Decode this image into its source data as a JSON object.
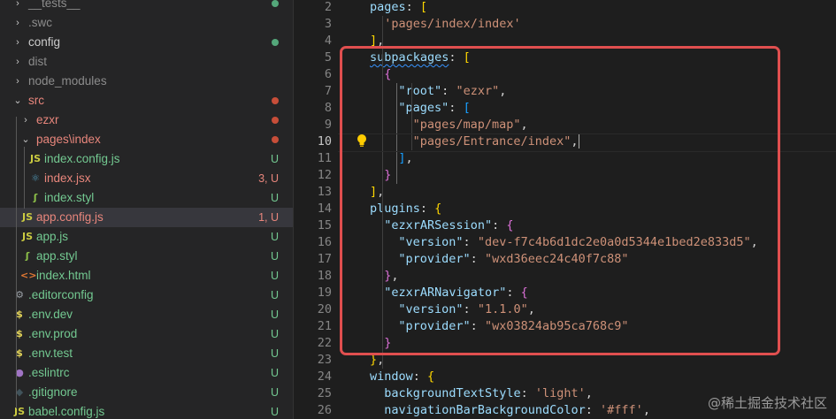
{
  "explorer": {
    "items": [
      {
        "name": "__tests__",
        "type": "folder",
        "indent": 0,
        "color": "#8c8c8c",
        "dot": "#54a77a"
      },
      {
        "name": ".swc",
        "type": "folder",
        "indent": 0,
        "color": "#8c8c8c",
        "dot": null
      },
      {
        "name": "config",
        "type": "folder",
        "indent": 0,
        "color": "#cccccc",
        "dot": "#54a77a"
      },
      {
        "name": "dist",
        "type": "folder",
        "indent": 0,
        "color": "#8c8c8c",
        "dot": null
      },
      {
        "name": "node_modules",
        "type": "folder",
        "indent": 0,
        "color": "#8c8c8c",
        "dot": null
      },
      {
        "name": "src",
        "type": "folder-open",
        "indent": 0,
        "color": "#e8867c",
        "dot": "#c74e39"
      },
      {
        "name": "ezxr",
        "type": "folder",
        "indent": 1,
        "color": "#e8867c",
        "dot": "#c74e39"
      },
      {
        "name": "pages\\index",
        "type": "folder-open",
        "indent": 1,
        "color": "#e8867c",
        "dot": "#c74e39"
      },
      {
        "name": "index.config.js",
        "type": "js",
        "indent": 2,
        "color": "#73c991",
        "badge": "U",
        "badgeColor": "#73c991"
      },
      {
        "name": "index.jsx",
        "type": "jsx",
        "indent": 2,
        "color": "#e8867c",
        "badge": "3, U",
        "badgeColor": "#e8867c"
      },
      {
        "name": "index.styl",
        "type": "styl",
        "indent": 2,
        "color": "#73c991",
        "badge": "U",
        "badgeColor": "#73c991"
      },
      {
        "name": "app.config.js",
        "type": "js",
        "indent": 1,
        "color": "#e8867c",
        "badge": "1, U",
        "badgeColor": "#e8867c",
        "active": true
      },
      {
        "name": "app.js",
        "type": "js",
        "indent": 1,
        "color": "#73c991",
        "badge": "U",
        "badgeColor": "#73c991"
      },
      {
        "name": "app.styl",
        "type": "styl",
        "indent": 1,
        "color": "#73c991",
        "badge": "U",
        "badgeColor": "#73c991"
      },
      {
        "name": "index.html",
        "type": "html",
        "indent": 1,
        "color": "#73c991",
        "badge": "U",
        "badgeColor": "#73c991"
      },
      {
        "name": ".editorconfig",
        "type": "gear",
        "indent": 0,
        "color": "#73c991",
        "badge": "U",
        "badgeColor": "#73c991"
      },
      {
        "name": ".env.dev",
        "type": "env",
        "indent": 0,
        "color": "#73c991",
        "badge": "U",
        "badgeColor": "#73c991"
      },
      {
        "name": ".env.prod",
        "type": "env",
        "indent": 0,
        "color": "#73c991",
        "badge": "U",
        "badgeColor": "#73c991"
      },
      {
        "name": ".env.test",
        "type": "env",
        "indent": 0,
        "color": "#73c991",
        "badge": "U",
        "badgeColor": "#73c991"
      },
      {
        "name": ".eslintrc",
        "type": "eslint",
        "indent": 0,
        "color": "#73c991",
        "badge": "U",
        "badgeColor": "#73c991"
      },
      {
        "name": ".gitignore",
        "type": "git",
        "indent": 0,
        "color": "#73c991",
        "badge": "U",
        "badgeColor": "#73c991"
      },
      {
        "name": "babel.config.js",
        "type": "js",
        "indent": 0,
        "color": "#73c991",
        "badge": "U",
        "badgeColor": "#73c991"
      }
    ]
  },
  "editor": {
    "current_line": 10,
    "lines": [
      {
        "n": "2",
        "tokens": [
          [
            "k",
            "pages"
          ],
          [
            "p",
            ": "
          ],
          [
            "b1",
            "["
          ]
        ],
        "indent": 1
      },
      {
        "n": "3",
        "tokens": [
          [
            "s",
            "'pages/index/index'"
          ]
        ],
        "indent": 2
      },
      {
        "n": "4",
        "tokens": [
          [
            "b1",
            "]"
          ],
          [
            "p",
            ","
          ]
        ],
        "indent": 1
      },
      {
        "n": "5",
        "tokens": [
          [
            "k squig",
            "subpackages"
          ],
          [
            "p",
            ": "
          ],
          [
            "b1",
            "["
          ]
        ],
        "indent": 1
      },
      {
        "n": "6",
        "tokens": [
          [
            "b2",
            "{"
          ]
        ],
        "indent": 2
      },
      {
        "n": "7",
        "tokens": [
          [
            "k",
            "\"root\""
          ],
          [
            "p",
            ": "
          ],
          [
            "s",
            "\"ezxr\""
          ],
          [
            "p",
            ","
          ]
        ],
        "indent": 3
      },
      {
        "n": "8",
        "tokens": [
          [
            "k",
            "\"pages\""
          ],
          [
            "p",
            ": "
          ],
          [
            "b3",
            "["
          ]
        ],
        "indent": 3
      },
      {
        "n": "9",
        "tokens": [
          [
            "s",
            "\"pages/map/map\""
          ],
          [
            "p",
            ","
          ]
        ],
        "indent": 4
      },
      {
        "n": "10",
        "tokens": [
          [
            "s",
            "\"pages/Entrance/index\""
          ],
          [
            "p",
            ","
          ]
        ],
        "indent": 4,
        "cursor": true
      },
      {
        "n": "11",
        "tokens": [
          [
            "b3",
            "]"
          ],
          [
            "p",
            ","
          ]
        ],
        "indent": 3
      },
      {
        "n": "12",
        "tokens": [
          [
            "b2",
            "}"
          ]
        ],
        "indent": 2
      },
      {
        "n": "13",
        "tokens": [
          [
            "b1",
            "]"
          ],
          [
            "p",
            ","
          ]
        ],
        "indent": 1
      },
      {
        "n": "14",
        "tokens": [
          [
            "k",
            "plugins"
          ],
          [
            "p",
            ": "
          ],
          [
            "b1",
            "{"
          ]
        ],
        "indent": 1
      },
      {
        "n": "15",
        "tokens": [
          [
            "k",
            "\"ezxrARSession\""
          ],
          [
            "p",
            ": "
          ],
          [
            "b2",
            "{"
          ]
        ],
        "indent": 2
      },
      {
        "n": "16",
        "tokens": [
          [
            "k",
            "\"version\""
          ],
          [
            "p",
            ": "
          ],
          [
            "s",
            "\"dev-f7c4b6d1dc2e0a0d5344e1bed2e833d5\""
          ],
          [
            "p",
            ","
          ]
        ],
        "indent": 3
      },
      {
        "n": "17",
        "tokens": [
          [
            "k",
            "\"provider\""
          ],
          [
            "p",
            ": "
          ],
          [
            "s",
            "\"wxd36eec24c40f7c88\""
          ]
        ],
        "indent": 3
      },
      {
        "n": "18",
        "tokens": [
          [
            "b2",
            "}"
          ],
          [
            "p",
            ","
          ]
        ],
        "indent": 2
      },
      {
        "n": "19",
        "tokens": [
          [
            "k",
            "\"ezxrARNavigator\""
          ],
          [
            "p",
            ": "
          ],
          [
            "b2",
            "{"
          ]
        ],
        "indent": 2
      },
      {
        "n": "20",
        "tokens": [
          [
            "k",
            "\"version\""
          ],
          [
            "p",
            ": "
          ],
          [
            "s",
            "\"1.1.0\""
          ],
          [
            "p",
            ","
          ]
        ],
        "indent": 3
      },
      {
        "n": "21",
        "tokens": [
          [
            "k",
            "\"provider\""
          ],
          [
            "p",
            ": "
          ],
          [
            "s",
            "\"wx03824ab95ca768c9\""
          ]
        ],
        "indent": 3
      },
      {
        "n": "22",
        "tokens": [
          [
            "b2",
            "}"
          ]
        ],
        "indent": 2
      },
      {
        "n": "23",
        "tokens": [
          [
            "b1",
            "}"
          ],
          [
            "p",
            ","
          ]
        ],
        "indent": 1
      },
      {
        "n": "24",
        "tokens": [
          [
            "k",
            "window"
          ],
          [
            "p",
            ": "
          ],
          [
            "b1",
            "{"
          ]
        ],
        "indent": 1
      },
      {
        "n": "25",
        "tokens": [
          [
            "k",
            "backgroundTextStyle"
          ],
          [
            "p",
            ": "
          ],
          [
            "s",
            "'light'"
          ],
          [
            "p",
            ","
          ]
        ],
        "indent": 2
      },
      {
        "n": "26",
        "tokens": [
          [
            "k",
            "navigationBarBackgroundColor"
          ],
          [
            "p",
            ": "
          ],
          [
            "s",
            "'#fff'"
          ],
          [
            "p",
            ","
          ]
        ],
        "indent": 2
      }
    ]
  },
  "watermark": "@稀土掘金技术社区",
  "colors": {
    "accent": "#e04f4f",
    "untracked": "#73c991",
    "modified": "#e8867c"
  }
}
